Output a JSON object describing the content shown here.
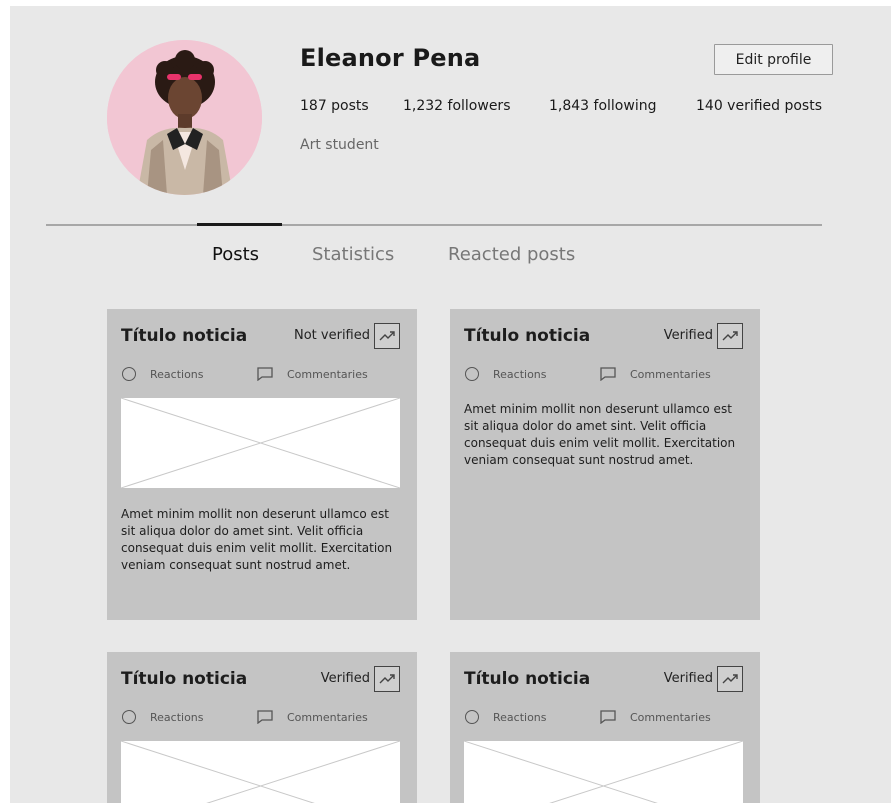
{
  "profile": {
    "name": "Eleanor Pena",
    "edit_label": "Edit profile",
    "stats": {
      "posts": "187 posts",
      "followers": "1,232 followers",
      "following": "1,843 following",
      "verified": "140 verified posts"
    },
    "bio": "Art student",
    "avatar_bg": "#f2c6d3"
  },
  "tabs": [
    {
      "label": "Posts",
      "active": true
    },
    {
      "label": "Statistics",
      "active": false
    },
    {
      "label": "Reacted posts",
      "active": false
    }
  ],
  "posts": [
    {
      "title": "Título noticia",
      "status": "Not verified",
      "reactions_label": "Reactions",
      "comments_label": "Commentaries",
      "body": "Amet minim mollit non deserunt ullamco est sit aliqua dolor do amet sint. Velit officia consequat duis enim velit mollit. Exercitation veniam consequat sunt nostrud amet."
    },
    {
      "title": "Título noticia",
      "status": "Verified",
      "reactions_label": "Reactions",
      "comments_label": "Commentaries",
      "body": "Amet minim mollit non deserunt ullamco est sit aliqua dolor do amet sint. Velit officia consequat duis enim velit mollit. Exercitation veniam consequat sunt nostrud amet."
    },
    {
      "title": "Título noticia",
      "status": "Verified",
      "reactions_label": "Reactions",
      "comments_label": "Commentaries"
    },
    {
      "title": "Título noticia",
      "status": "Verified",
      "reactions_label": "Reactions",
      "comments_label": "Commentaries"
    }
  ],
  "icons": {
    "trend": "trending-up-icon",
    "reactions": "circle-icon",
    "comments": "comment-icon",
    "image": "image-placeholder"
  },
  "colors": {
    "page_bg": "#e8e8e8",
    "card_bg": "#c4c4c4",
    "active_tab": "#111111",
    "inactive_tab": "#777777"
  }
}
